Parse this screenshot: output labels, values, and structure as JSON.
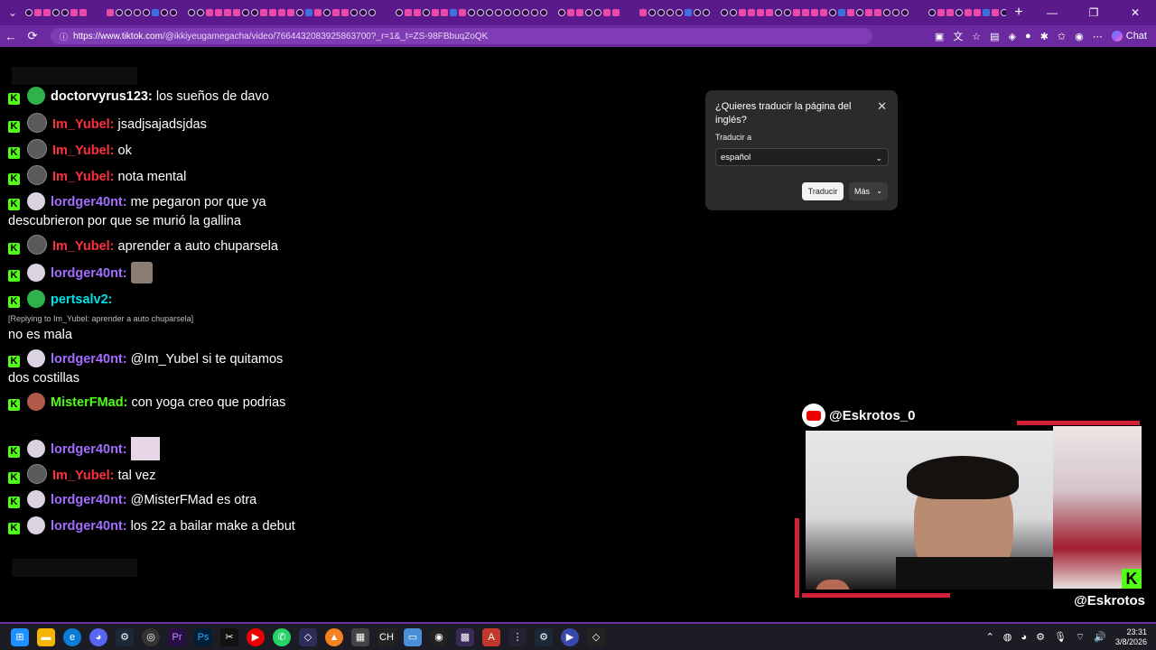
{
  "browser": {
    "url_host": "https://www.tiktok.com",
    "url_path": "/@ikkiyeugamegacha/video/7664432083925863700?_r=1&_t=ZS-98FBbuqZoQK",
    "chat_label": "Chat",
    "new_tab": "+",
    "win_min": "—",
    "win_max": "❐",
    "win_close": "✕"
  },
  "chat": {
    "messages": [
      {
        "user": "doctorvyrus123:",
        "text": "los sueños de davo",
        "color": "#ffffff"
      },
      {
        "user": "Im_Yubel:",
        "text": "jsadjsajadsjdas",
        "color": "#ff2e3e"
      },
      {
        "user": "Im_Yubel:",
        "text": "ok",
        "color": "#ff2e3e"
      },
      {
        "user": "Im_Yubel:",
        "text": "nota mental",
        "color": "#ff2e3e"
      },
      {
        "user": "lordger40nt:",
        "text": "me pegaron por que ya descubrieron por que se murió la gallina",
        "color": "#a46cff"
      },
      {
        "user": "Im_Yubel:",
        "text": "aprender a auto chuparsela",
        "color": "#ff2e3e"
      },
      {
        "user": "lordger40nt:",
        "text": "",
        "color": "#a46cff"
      },
      {
        "user": "pertsalv2:",
        "text": "",
        "color": "#00e0e6"
      },
      {
        "user": "",
        "text": "no es mala",
        "color": "#ffffff"
      },
      {
        "user": "lordger40nt:",
        "text": "@Im_Yubel si te quitamos dos costillas",
        "color": "#a46cff"
      },
      {
        "user": "MisterFMad:",
        "text": "con yoga creo que podrias",
        "color": "#53fc18"
      },
      {
        "user": "lordger40nt:",
        "text": "",
        "color": "#a46cff"
      },
      {
        "user": "Im_Yubel:",
        "text": "tal vez",
        "color": "#ff2e3e"
      },
      {
        "user": "lordger40nt:",
        "text": "@MisterFMad es otra",
        "color": "#a46cff"
      },
      {
        "user": "lordger40nt:",
        "text": "los 22 a bailar make a debut",
        "color": "#a46cff"
      }
    ],
    "reply_note": "[Replying to Im_Yubel: aprender a auto chuparsela]"
  },
  "translate_popup": {
    "title": "¿Quieres traducir la página del inglés?",
    "translate_to_label": "Traducir a",
    "selected_language": "español",
    "translate_button": "Traducir",
    "more_button": "Más"
  },
  "cam": {
    "top_handle": "@Eskrotos_0",
    "bottom_handle": "@Eskrotos"
  },
  "taskbar": {
    "time": "23:31",
    "date": "3/8/2026"
  }
}
